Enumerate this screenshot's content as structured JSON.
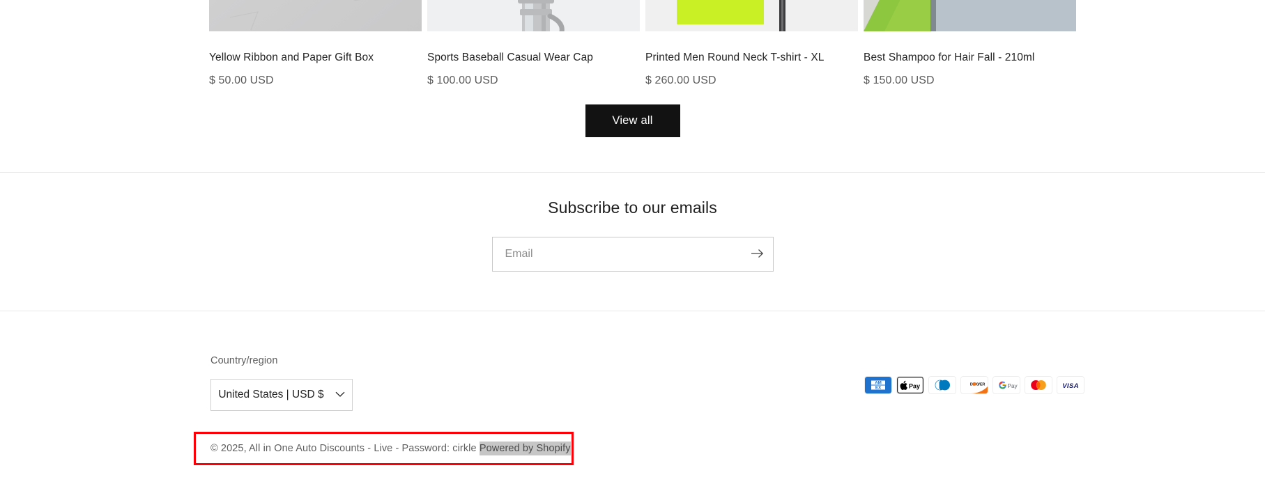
{
  "products": [
    {
      "title": "Yellow Ribbon and Paper Gift Box",
      "price": "$ 50.00 USD",
      "image": "concrete-stone-texture"
    },
    {
      "title": "Sports Baseball Casual Wear Cap",
      "price": "$ 100.00 USD",
      "image": "metal-bottle-neck"
    },
    {
      "title": "Printed Men Round Neck T-shirt - XL",
      "price": "$ 260.00 USD",
      "image": "yellow-green-fabric"
    },
    {
      "title": "Best Shampoo for Hair Fall - 210ml",
      "price": "$ 150.00 USD",
      "image": "green-triangle-gray"
    }
  ],
  "collection": {
    "view_all_label": "View all"
  },
  "newsletter": {
    "heading": "Subscribe to our emails",
    "email_placeholder": "Email",
    "email_value": "",
    "submit_icon": "arrow-right-icon"
  },
  "footer": {
    "country_label": "Country/region",
    "country_value": "United States | USD $",
    "chevron_icon": "chevron-down-icon",
    "payments": [
      "american-express",
      "apple-pay",
      "diners-club",
      "discover",
      "google-pay",
      "mastercard",
      "visa"
    ],
    "copyright_prefix": "© 2025, ",
    "shop_name": "All in One Auto Discounts - Live - Password: cirkle",
    "powered_by": "Powered by Shopify"
  },
  "annotation": {
    "highlight_color": "#fb0007"
  }
}
